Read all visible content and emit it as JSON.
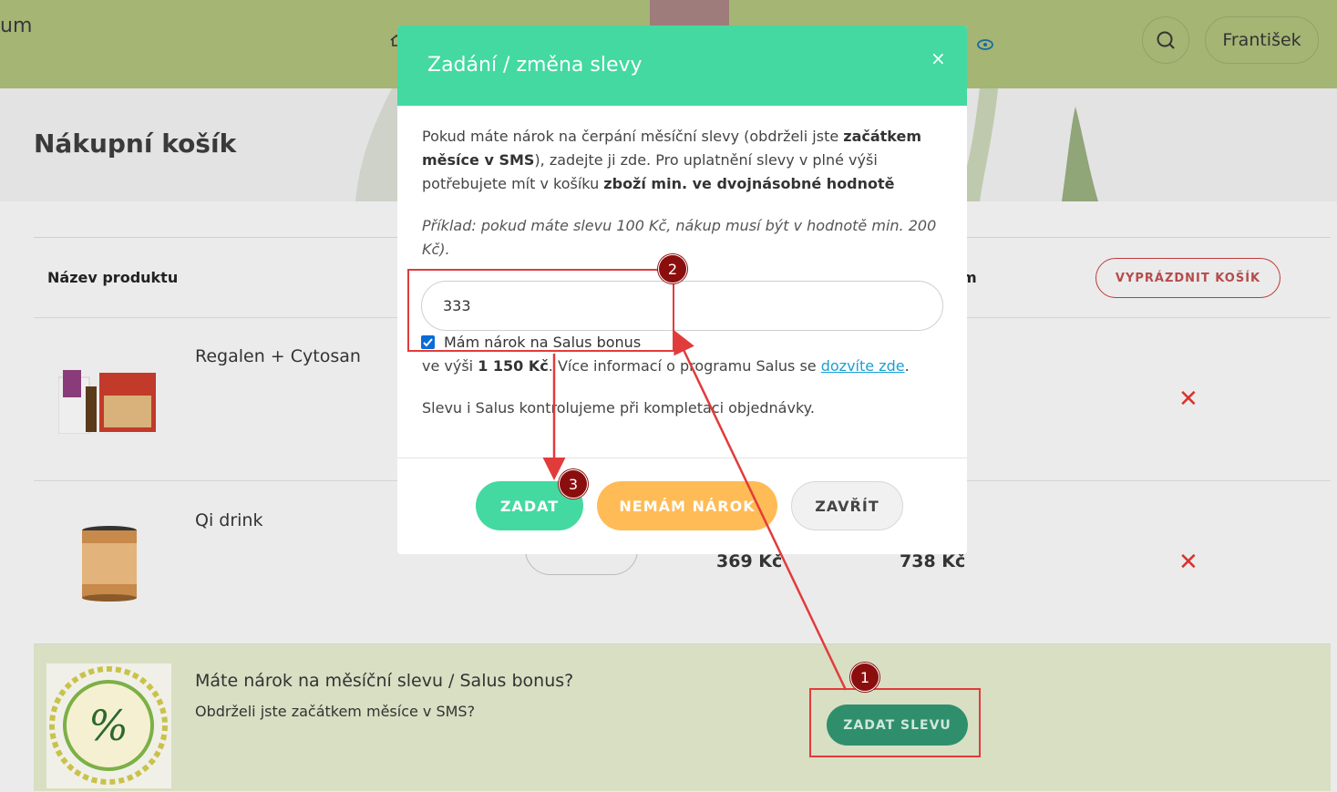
{
  "header": {
    "logo_text": "um",
    "user_label": "František"
  },
  "page": {
    "title": "Nákupní košík"
  },
  "table": {
    "col_name": "Název produktu",
    "col_total": "m",
    "empty_cart_label": "VYPRÁZDNIT KOŠÍK",
    "rows": [
      {
        "name": "Regalen + Cytosan",
        "unit_price": "",
        "total_price": ""
      },
      {
        "name": "Qi drink",
        "unit_price": "369 Kč",
        "total_price": "738 Kč"
      }
    ],
    "remove_symbol": "✕"
  },
  "bonus": {
    "title": "Máte nárok na měsíční slevu / Salus bonus?",
    "subtitle": "Obdrželi jste začátkem měsíce v SMS?",
    "button_label": "ZADAT SLEVU"
  },
  "modal": {
    "title": "Zadání / změna slevy",
    "close_symbol": "×",
    "p1_a": "Pokud máte nárok na čerpání měsíční slevy (obdrželi jste ",
    "p1_b": "začátkem",
    "p1_c": "měsíce v SMS",
    "p1_d": "), zadejte ji zde. Pro uplatnění slevy v plné výši",
    "p1_e": "potřebujete mít v košíku ",
    "p1_f": "zboží min. ve dvojnásobné hodnotě",
    "example": "Příklad: pokud máte slevu 100 Kč, nákup musí být v hodnotě min. 200 Kč).",
    "input_value": "333",
    "checkbox_label": "Mám nárok na Salus bonus",
    "salus_a": "ve výši ",
    "salus_amount": "1 150 Kč",
    "salus_b": ". Více informací o programu Salus se ",
    "salus_link": "dozvíte zde",
    "salus_c": ".",
    "check_note": "Slevu i Salus kontrolujeme při kompletaci objednávky.",
    "btn_submit": "ZADAT",
    "btn_no_claim": "NEMÁM NÁROK",
    "btn_close": "ZAVŘÍT"
  },
  "annotations": {
    "badge_1": "1",
    "badge_2": "2",
    "badge_3": "3",
    "color": "#e23b3b"
  }
}
